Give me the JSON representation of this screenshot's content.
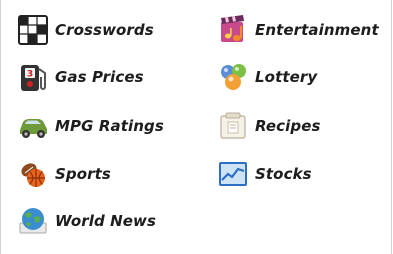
{
  "links": {
    "crosswords": {
      "label": "Crosswords",
      "icon": "crossword-grid-icon"
    },
    "entertainment": {
      "label": "Entertainment",
      "icon": "clapperboard-music-icon"
    },
    "gas_prices": {
      "label": "Gas Prices",
      "icon": "gas-price-sign-icon"
    },
    "lottery": {
      "label": "Lottery",
      "icon": "lottery-balls-icon"
    },
    "mpg_ratings": {
      "label": "MPG Ratings",
      "icon": "car-icon"
    },
    "recipes": {
      "label": "Recipes",
      "icon": "recipe-card-icon"
    },
    "sports": {
      "label": "Sports",
      "icon": "sports-balls-icon"
    },
    "stocks": {
      "label": "Stocks",
      "icon": "stock-chart-icon"
    },
    "world_news": {
      "label": "World News",
      "icon": "globe-icon"
    }
  }
}
